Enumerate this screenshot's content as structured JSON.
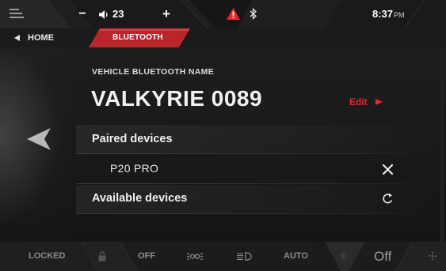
{
  "status_bar": {
    "volume": "23",
    "volume_minus": "−",
    "volume_plus": "+",
    "time": "8:37",
    "time_suffix": "PM",
    "warning_icon": "warning-triangle-icon",
    "bluetooth_icon": "bluetooth-icon",
    "menu_icon": "menu-lines-icon"
  },
  "breadcrumb": {
    "home": "HOME",
    "current": "BLUETOOTH"
  },
  "main": {
    "vehicle_label": "VEHICLE BLUETOOTH NAME",
    "vehicle_name": "VALKYRIE 0089",
    "edit": "Edit",
    "paired_title": "Paired devices",
    "paired_devices": [
      {
        "name": "P20 PRO",
        "action_icon": "close-icon"
      }
    ],
    "available_title": "Available devices",
    "refresh_icon": "refresh-icon"
  },
  "bottom_bar": {
    "locked": "LOCKED",
    "lights": "OFF",
    "headlights": "AUTO",
    "fan": "Off"
  },
  "colors": {
    "accent": "#e8282f",
    "background": "#161616",
    "text": "#e6e6e6"
  }
}
